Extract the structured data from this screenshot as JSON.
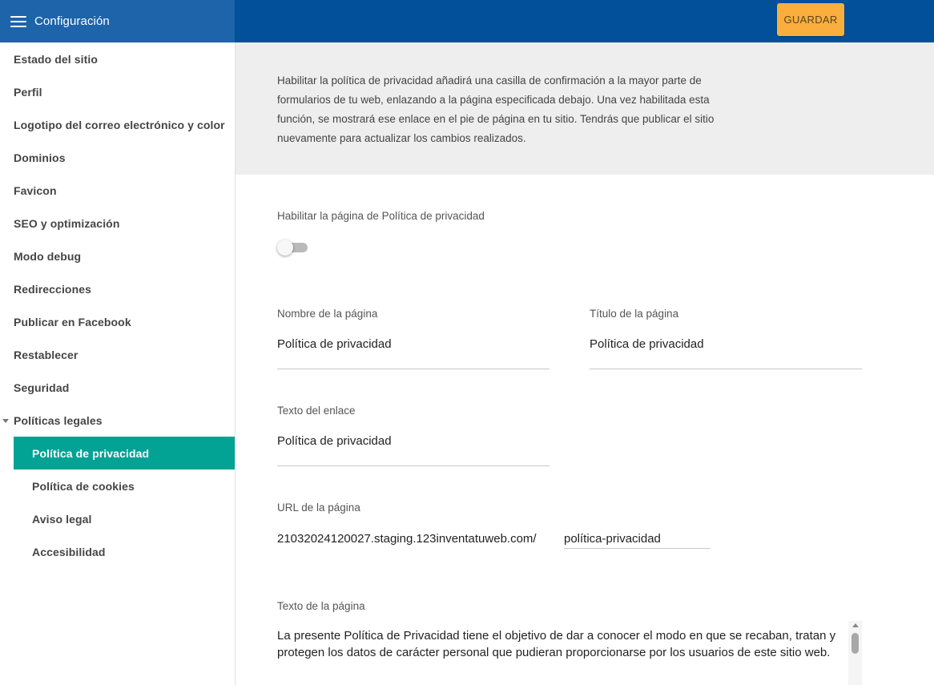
{
  "header": {
    "title": "Configuración",
    "save_label": "GUARDAR"
  },
  "sidebar": {
    "items": [
      {
        "label": "Estado del sitio"
      },
      {
        "label": "Perfil"
      },
      {
        "label": "Logotipo del correo electrónico y color"
      },
      {
        "label": "Dominios"
      },
      {
        "label": "Favicon"
      },
      {
        "label": "SEO y optimización"
      },
      {
        "label": "Modo debug"
      },
      {
        "label": "Redirecciones"
      },
      {
        "label": "Publicar en Facebook"
      },
      {
        "label": "Restablecer"
      },
      {
        "label": "Seguridad"
      }
    ],
    "group": {
      "label": "Políticas legales",
      "expanded": true,
      "items": [
        {
          "label": "Política de privacidad",
          "active": true
        },
        {
          "label": "Política de cookies"
        },
        {
          "label": "Aviso legal"
        },
        {
          "label": "Accesibilidad"
        }
      ]
    }
  },
  "main": {
    "info": "Habilitar la política de privacidad añadirá una casilla de confirmación a la mayor parte de formularios de tu web, enlazando a la página especificada debajo. Una vez habilitada esta función, se mostrará ese enlace en el pie de página en tu sitio. Tendrás que publicar el sitio nuevamente para actualizar los cambios realizados.",
    "enable_label": "Habilitar la página de Política de privacidad",
    "enabled": false,
    "page_name": {
      "label": "Nombre de la página",
      "value": "Política de privacidad"
    },
    "page_title": {
      "label": "Título de la página",
      "value": "Política de privacidad"
    },
    "link_text": {
      "label": "Texto del enlace",
      "value": "Política de privacidad"
    },
    "page_url": {
      "label": "URL de la página",
      "domain": "21032024120027.staging.123inventatuweb.com/",
      "slug": "política-privacidad"
    },
    "page_text": {
      "label": "Texto de la página",
      "value": "La presente Política de Privacidad tiene el objetivo de dar a conocer el modo en que se recaban, tratan y protegen los datos de carácter personal que pudieran proporcionarse por los usuarios de este sitio web."
    }
  },
  "colors": {
    "header": "#02509a",
    "header_left": "#1d64aa",
    "save_button": "#f9ae3e",
    "active_item": "#02a295"
  }
}
